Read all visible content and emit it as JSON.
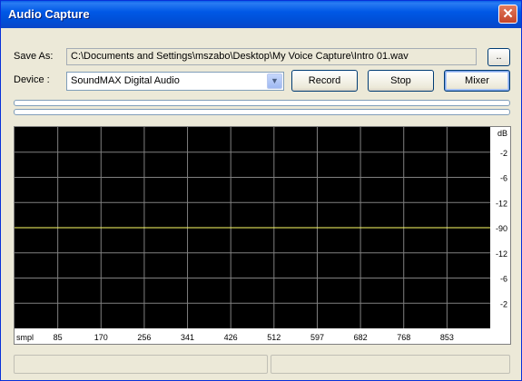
{
  "window": {
    "title": "Audio Capture"
  },
  "form": {
    "save_label": "Save As:",
    "path": "C:\\Documents and Settings\\mszabo\\Desktop\\My Voice Capture\\Intro 01.wav",
    "browse_label": "..",
    "device_label": "Device :",
    "device_value": "SoundMAX Digital Audio"
  },
  "buttons": {
    "record": "Record",
    "stop": "Stop",
    "mixer": "Mixer"
  },
  "plot": {
    "background": "#000000",
    "grid_color": "#808080",
    "trace_color": "#ffff66",
    "right_labels": [
      "dB",
      "-2",
      "-6",
      "-12",
      "-90",
      "-12",
      "-6",
      "-2"
    ],
    "bottom_labels": [
      "smpl",
      "85",
      "170",
      "256",
      "341",
      "426",
      "512",
      "597",
      "682",
      "768",
      "853"
    ]
  }
}
